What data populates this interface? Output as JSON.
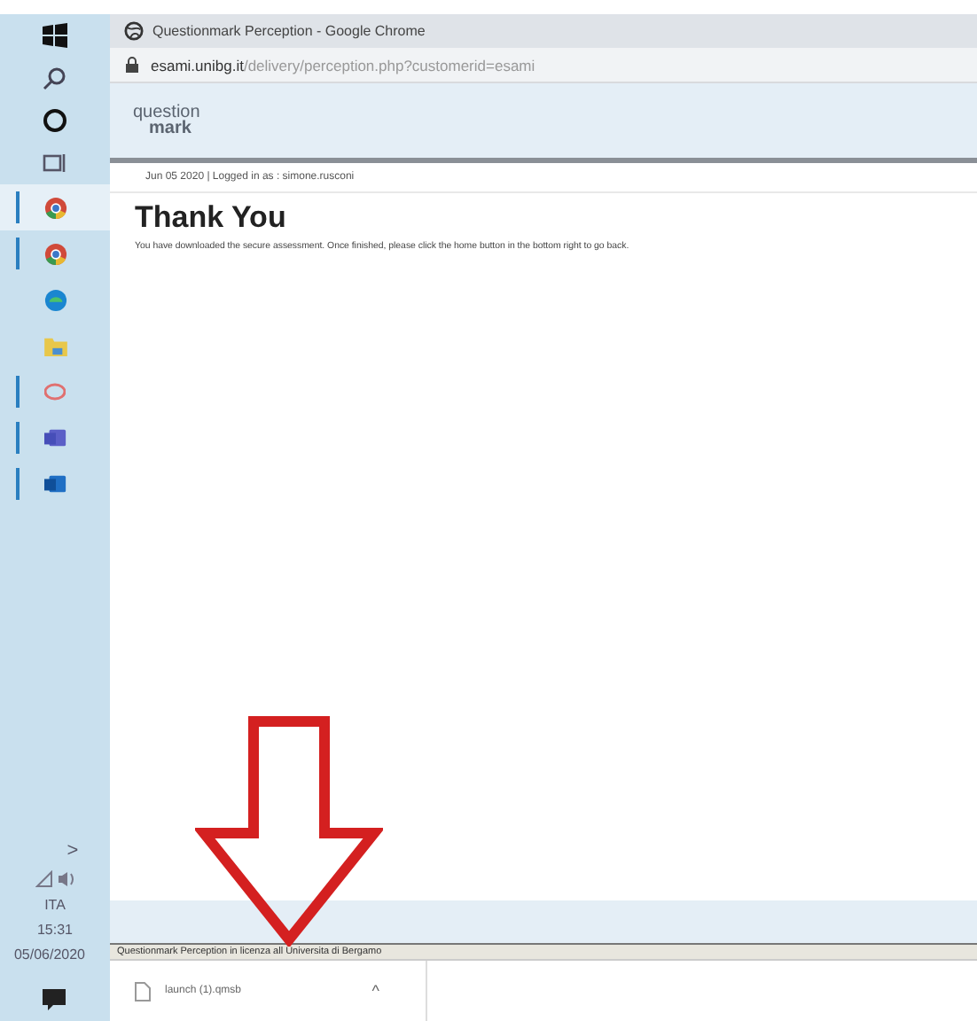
{
  "taskbar": {
    "top": [
      {
        "kind": "windows"
      },
      {
        "kind": "search"
      },
      {
        "kind": "cortana"
      },
      {
        "kind": "taskview"
      }
    ],
    "pinned": [
      {
        "kind": "chrome",
        "selected": true,
        "running": true
      },
      {
        "kind": "chrome",
        "selected": false,
        "running": true
      },
      {
        "kind": "edge",
        "selected": false,
        "running": false
      },
      {
        "kind": "folder",
        "selected": false,
        "running": false
      },
      {
        "kind": "app",
        "selected": false,
        "running": true
      },
      {
        "kind": "teams",
        "selected": false,
        "running": true
      },
      {
        "kind": "outlook",
        "selected": false,
        "running": true
      }
    ],
    "tray": {
      "chevron": ">",
      "language": "ITA",
      "time": "15:31",
      "date": "05/06/2020"
    }
  },
  "window": {
    "title": "Questionmark Perception - Google Chrome",
    "url_host": "esami.unibg.it",
    "url_path": "/delivery/perception.php?customerid=esami"
  },
  "page": {
    "logo_top": "question",
    "logo_bottom": "mark",
    "session": "Jun 05 2020 | Logged in as : simone.rusconi",
    "heading": "Thank You",
    "message": "You have downloaded the secure assessment. Once finished, please click the home button in the bottom right to go back.",
    "footer": "Questionmark Perception in licenza all Universita di Bergamo"
  },
  "downloads": [
    {
      "name": "launch (1).qmsb",
      "caret": "^"
    }
  ]
}
